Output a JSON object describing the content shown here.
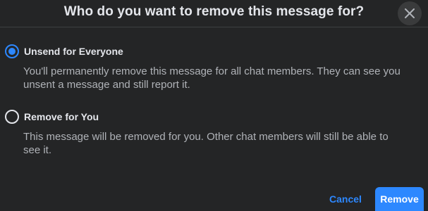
{
  "dialog": {
    "title": "Who do you want to remove this message for?",
    "close_icon": "close-icon"
  },
  "options": [
    {
      "label": "Unsend for Everyone",
      "description": "You'll permanently remove this message for all chat members. They can see you unsent a message and still report it.",
      "selected": true
    },
    {
      "label": "Remove for You",
      "description": "This message will be removed for you. Other chat members will still be able to see it.",
      "selected": false
    }
  ],
  "footer": {
    "cancel_label": "Cancel",
    "remove_label": "Remove"
  },
  "colors": {
    "background": "#242526",
    "accent": "#2d88ff",
    "text_primary": "#e4e6eb",
    "text_secondary": "#b0b3b8"
  }
}
